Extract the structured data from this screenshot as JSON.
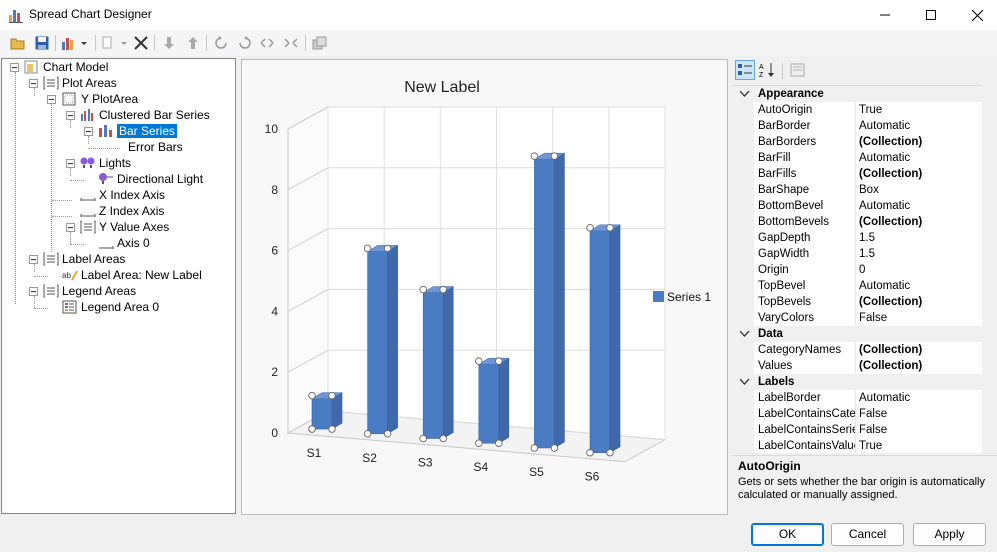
{
  "window": {
    "title": "Spread Chart Designer"
  },
  "tree": {
    "nodes": [
      {
        "label": "Chart Model"
      },
      {
        "label": "Plot Areas"
      },
      {
        "label": "Y PlotArea"
      },
      {
        "label": "Clustered Bar Series"
      },
      {
        "label": "Bar Series"
      },
      {
        "label": "Error Bars"
      },
      {
        "label": "Lights"
      },
      {
        "label": "Directional Light"
      },
      {
        "label": "X Index Axis"
      },
      {
        "label": "Z Index Axis"
      },
      {
        "label": "Y Value Axes"
      },
      {
        "label": "Axis 0"
      },
      {
        "label": "Label Areas"
      },
      {
        "label": "Label Area: New Label"
      },
      {
        "label": "Legend Areas"
      },
      {
        "label": "Legend Area 0"
      }
    ]
  },
  "chart_data": {
    "type": "bar",
    "title": "New Label",
    "categories": [
      "S1",
      "S2",
      "S3",
      "S4",
      "S5",
      "S6"
    ],
    "series": [
      {
        "name": "Series 1",
        "values": [
          1,
          6,
          4.8,
          2.6,
          9.5,
          7.3
        ],
        "color": "#4a7cc3"
      }
    ],
    "yticks": [
      "0",
      "2",
      "4",
      "6",
      "8",
      "10"
    ],
    "ylim": [
      0,
      10
    ],
    "legend": "right",
    "grid": true,
    "style": "3d"
  },
  "property_grid": {
    "rows": [
      {
        "kind": "cat",
        "name": "Appearance"
      },
      {
        "kind": "prop",
        "name": "AutoOrigin",
        "value": "True",
        "bold": false
      },
      {
        "kind": "prop",
        "name": "BarBorder",
        "value": "Automatic",
        "bold": false
      },
      {
        "kind": "prop",
        "name": "BarBorders",
        "value": "(Collection)",
        "bold": true
      },
      {
        "kind": "prop",
        "name": "BarFill",
        "value": "Automatic",
        "bold": false
      },
      {
        "kind": "prop",
        "name": "BarFills",
        "value": "(Collection)",
        "bold": true
      },
      {
        "kind": "prop",
        "name": "BarShape",
        "value": "Box",
        "bold": false
      },
      {
        "kind": "prop",
        "name": "BottomBevel",
        "value": "Automatic",
        "bold": false
      },
      {
        "kind": "prop",
        "name": "BottomBevels",
        "value": "(Collection)",
        "bold": true
      },
      {
        "kind": "prop",
        "name": "GapDepth",
        "value": "1.5",
        "bold": false
      },
      {
        "kind": "prop",
        "name": "GapWidth",
        "value": "1.5",
        "bold": false
      },
      {
        "kind": "prop",
        "name": "Origin",
        "value": "0",
        "bold": false
      },
      {
        "kind": "prop",
        "name": "TopBevel",
        "value": "Automatic",
        "bold": false
      },
      {
        "kind": "prop",
        "name": "TopBevels",
        "value": "(Collection)",
        "bold": true
      },
      {
        "kind": "prop",
        "name": "VaryColors",
        "value": "False",
        "bold": false
      },
      {
        "kind": "cat",
        "name": "Data"
      },
      {
        "kind": "prop",
        "name": "CategoryNames",
        "value": "(Collection)",
        "bold": true
      },
      {
        "kind": "prop",
        "name": "Values",
        "value": "(Collection)",
        "bold": true
      },
      {
        "kind": "cat",
        "name": "Labels"
      },
      {
        "kind": "prop",
        "name": "LabelBorder",
        "value": "Automatic",
        "bold": false
      },
      {
        "kind": "prop",
        "name": "LabelContainsCateg",
        "value": "False",
        "bold": false
      },
      {
        "kind": "prop",
        "name": "LabelContainsSeries",
        "value": "False",
        "bold": false
      },
      {
        "kind": "prop",
        "name": "LabelContainsValue",
        "value": "True",
        "bold": false
      }
    ],
    "description": {
      "title": "AutoOrigin",
      "text": "Gets or sets whether the bar origin is automatically calculated or manually assigned."
    }
  },
  "buttons": {
    "ok": "OK",
    "cancel": "Cancel",
    "apply": "Apply"
  }
}
